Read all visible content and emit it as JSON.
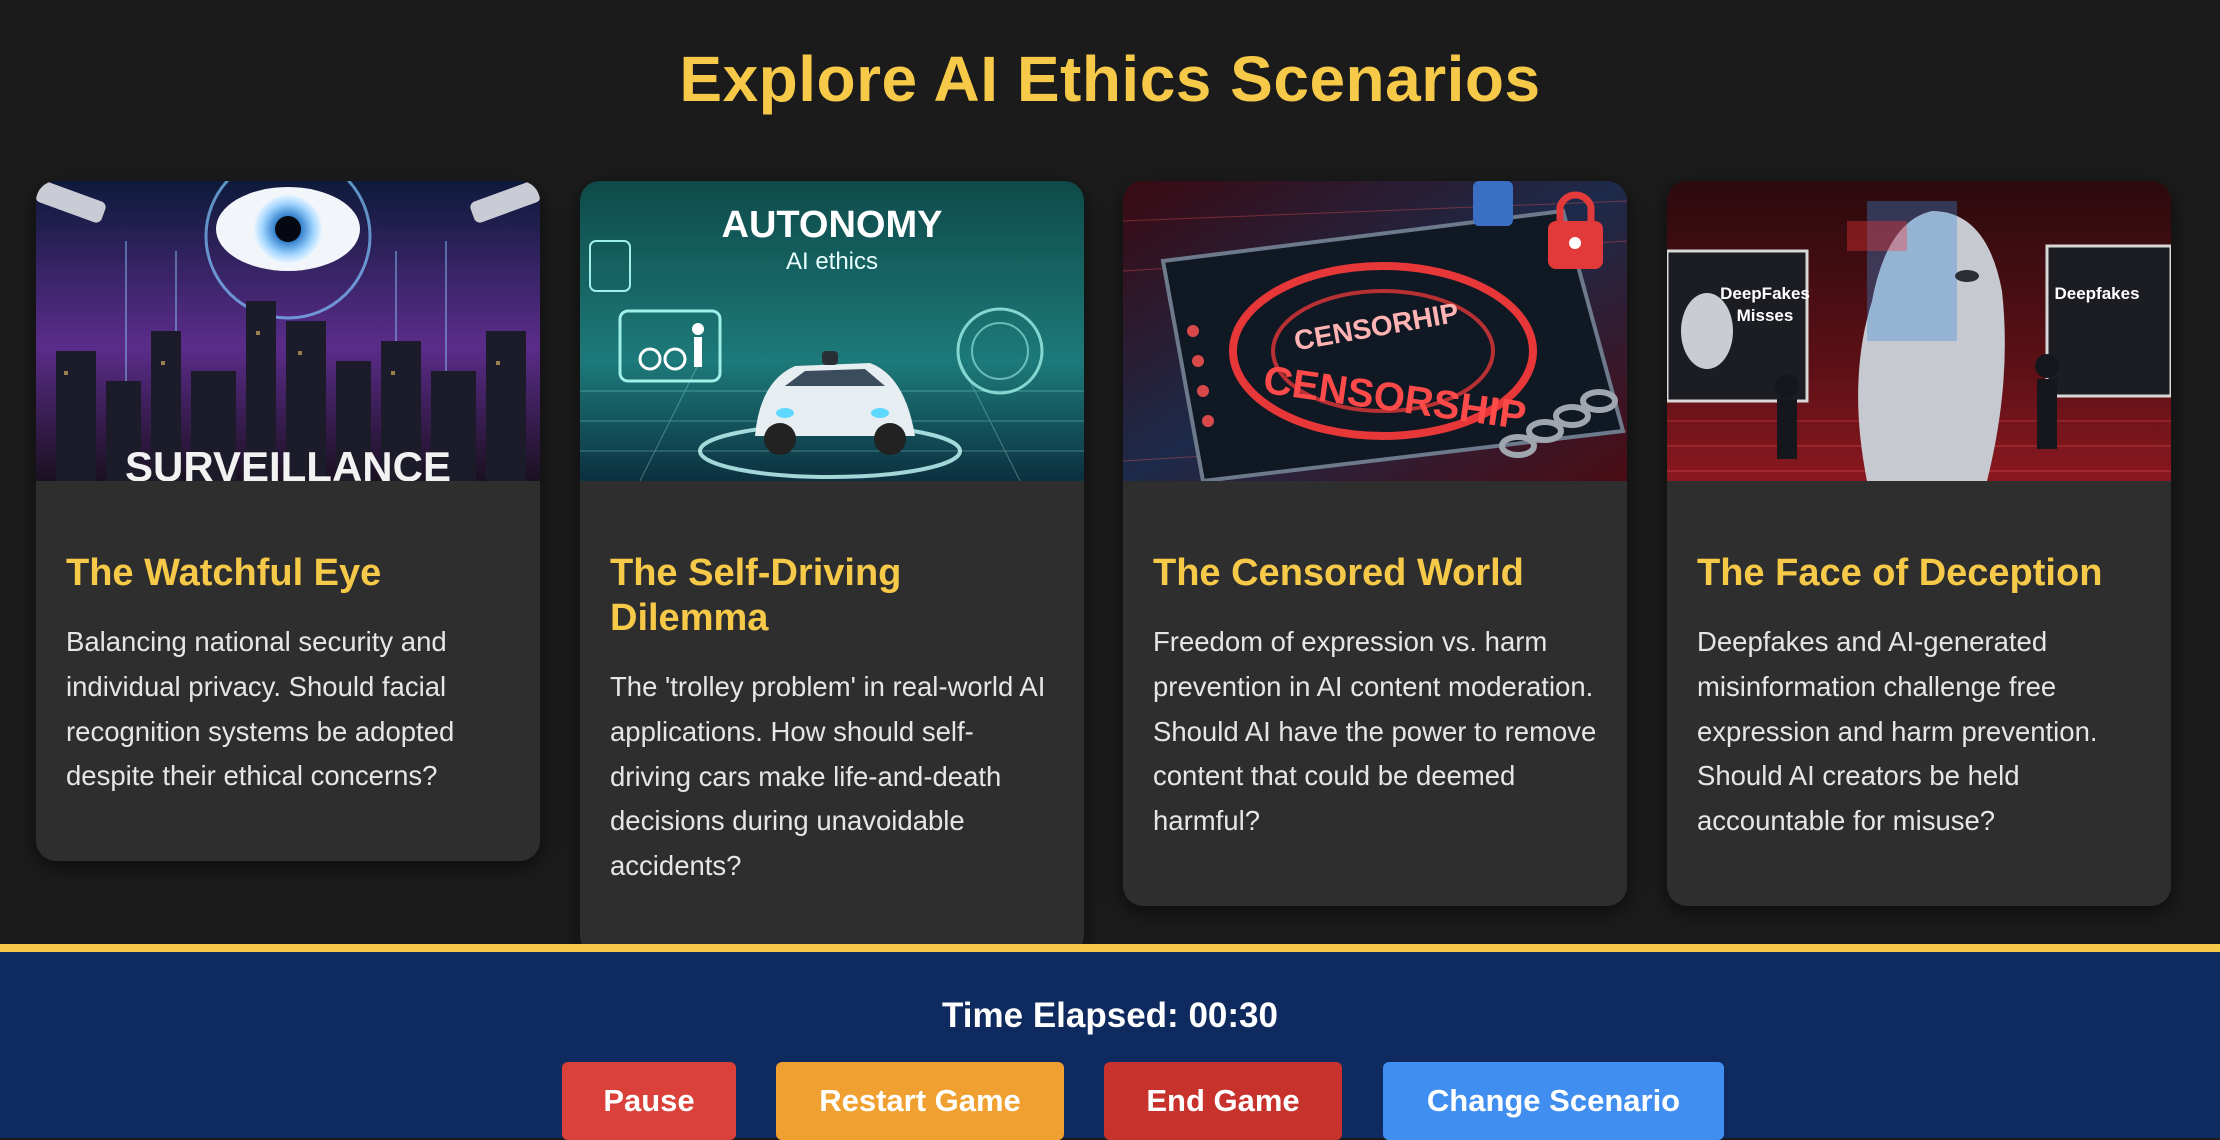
{
  "header": {
    "title": "Explore AI Ethics Scenarios"
  },
  "cards": [
    {
      "title": "The Watchful Eye",
      "description": "Balancing national security and individual privacy. Should facial recognition systems be adopted despite their ethical concerns?",
      "image_caption": "SURVEILLANCE",
      "icon": "eye-icon"
    },
    {
      "title": "The Self-Driving Dilemma",
      "description": "The 'trolley problem' in real-world AI applications. How should self-driving cars make life-and-death decisions during unavoidable accidents?",
      "image_caption": "AUTONOMY",
      "image_subcaption": "AI ethics",
      "icon": "car-icon"
    },
    {
      "title": "The Censored World",
      "description": "Freedom of expression vs. harm prevention in AI content moderation. Should AI have the power to remove content that could be deemed harmful?",
      "image_caption": "CENSORHIP",
      "image_caption2": "CENSORSHIP",
      "icon": "padlock-icon"
    },
    {
      "title": "The Face of Deception",
      "description": "Deepfakes and AI-generated misinformation challenge free expression and harm prevention. Should AI creators be held accountable for misuse?",
      "image_caption": "DeepFakes",
      "image_caption_b": "Misses",
      "image_caption2": "Deepfakes",
      "icon": "face-icon"
    }
  ],
  "footer": {
    "timer_label": "Time Elapsed:",
    "timer_value": "00:30",
    "buttons": {
      "pause": "Pause",
      "restart": "Restart Game",
      "end": "End Game",
      "change": "Change Scenario"
    }
  },
  "colors": {
    "accent": "#f7c948",
    "background": "#1b1b1b",
    "card": "#2e2e2e",
    "footer": "#0f2a5e",
    "pause": "#d9413a",
    "restart": "#f0a030",
    "end": "#c8322d",
    "change": "#3f8ef0"
  }
}
